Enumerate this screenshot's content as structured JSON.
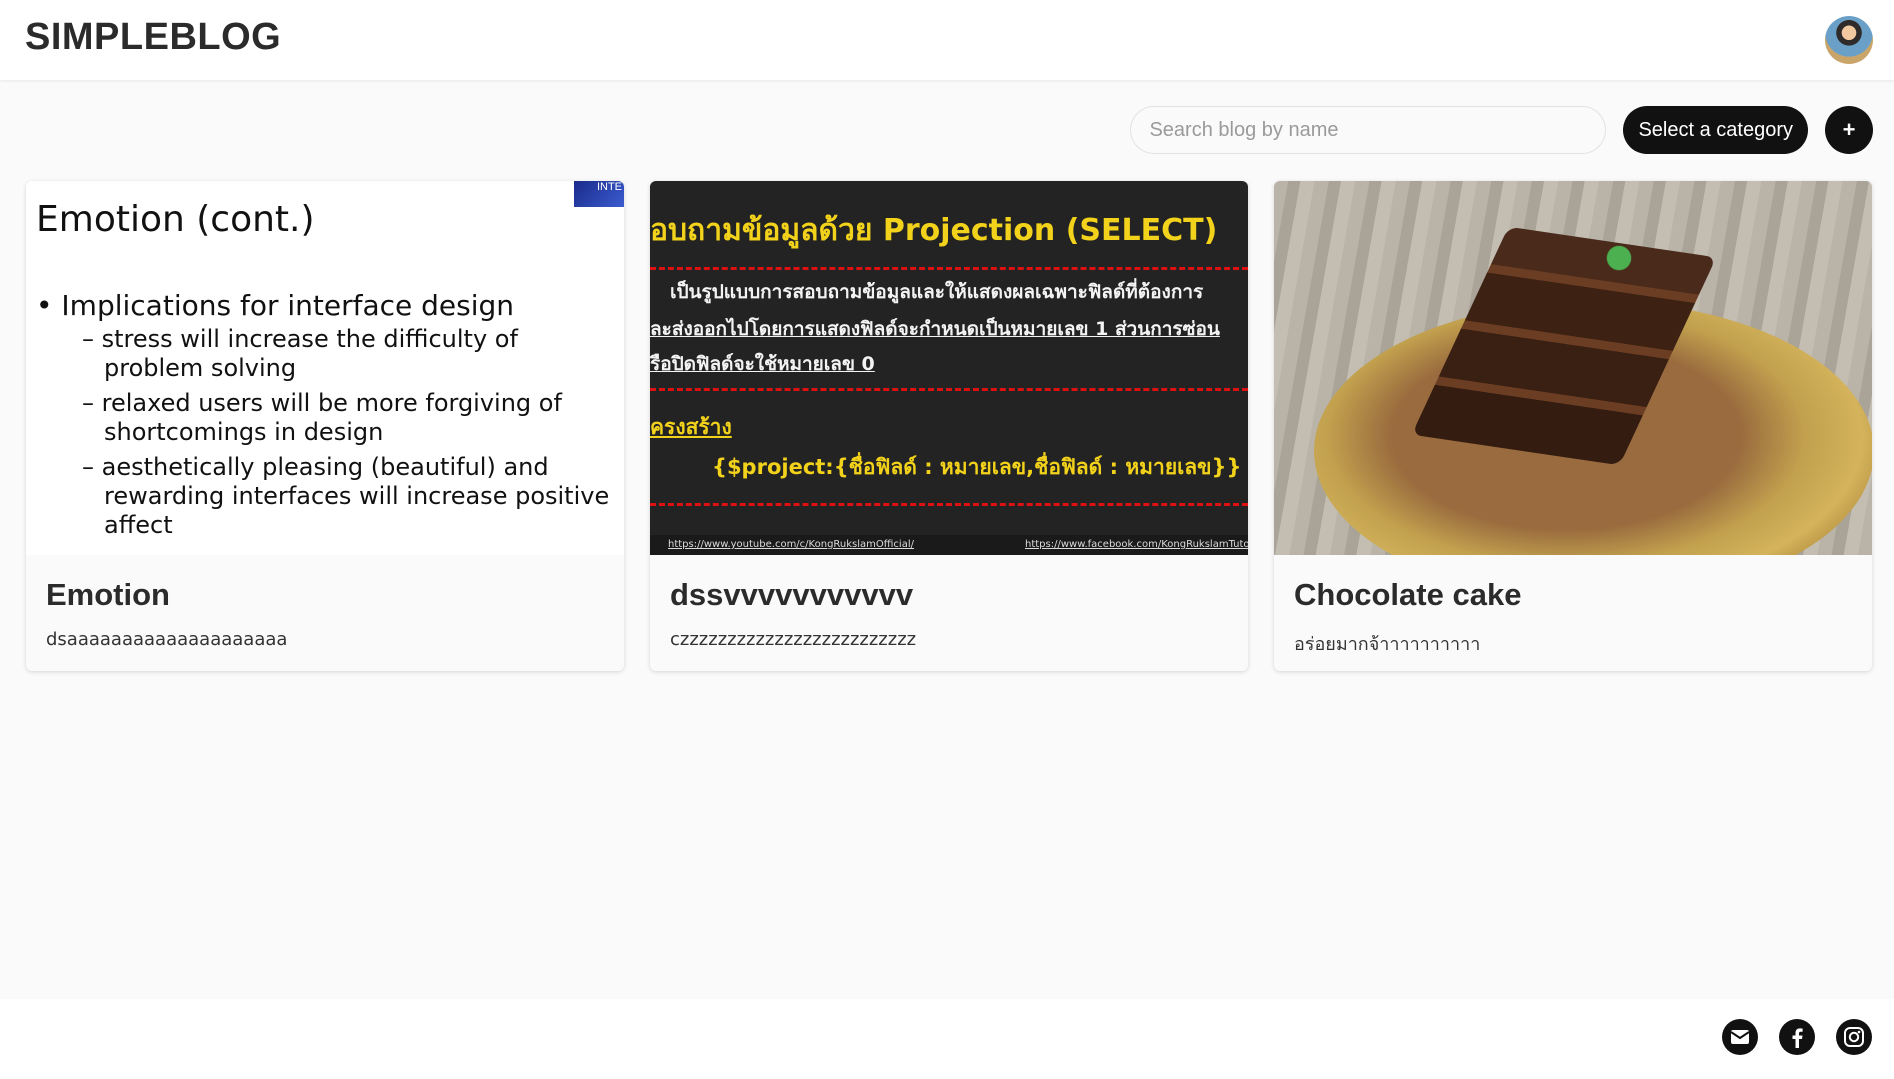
{
  "header": {
    "brand": "SIMPLEBLOG",
    "avatar_alt": "user avatar"
  },
  "toolbar": {
    "search_placeholder": "Search blog by name",
    "category_label": "Select a category",
    "add_label": "+"
  },
  "posts": [
    {
      "title": "Emotion",
      "description": "dsaaaaaaaaaaaaaaaaaaaa",
      "thumbnail": {
        "corner_text": "INTE",
        "heading": "Emotion (cont.)",
        "bullet": "• Implications for interface design",
        "subpoints": [
          "– stress will increase the difficulty of problem solving",
          "– relaxed users will be more forgiving of shortcomings in design",
          "– aesthetically pleasing (beautiful) and rewarding interfaces will increase positive affect"
        ]
      }
    },
    {
      "title": "dssvvvvvvvvvvv",
      "description": "czzzzzzzzzzzzzzzzzzzzzzzzz",
      "thumbnail": {
        "heading": "อบถามข้อมูลด้วย Projection (SELECT)",
        "line1": "เป็นรูปแบบการสอบถามข้อมูลและให้แสดงผลเฉพาะฟิลด์ที่ต้องการ",
        "line2": "ละส่งออกไปโดยการแสดงฟิลด์จะกำหนดเป็นหมายเลข 1 ส่วนการซ่อน",
        "line3": "รือปิดฟิลด์จะใช้หมายเลข 0",
        "line4": "ครงสร้าง",
        "code": "{$project:{ชื่อฟิลด์ : หมายเลข,ชื่อฟิลด์ : หมายเลข}}",
        "footer_left": "https://www.youtube.com/c/KongRukslamOfficial/",
        "footer_right": "https://www.facebook.com/KongRukslamTuto"
      }
    },
    {
      "title": "Chocolate cake",
      "description": "อร่อยมากจ้าาาาาาาาาา",
      "thumbnail": {
        "subject": "chocolate cake slice on plate"
      }
    }
  ],
  "footer": {
    "icons": [
      "mail-icon",
      "facebook-icon",
      "instagram-icon"
    ]
  }
}
